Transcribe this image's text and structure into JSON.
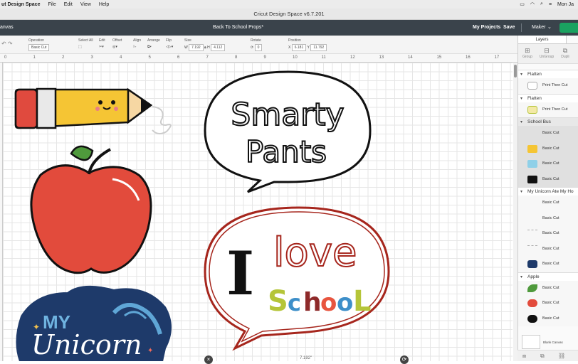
{
  "menubar": {
    "app_name": "ut Design Space",
    "items": [
      "File",
      "Edit",
      "View",
      "Help"
    ],
    "clock": "Mon Ja"
  },
  "window": {
    "title": "Cricut Design Space  v6.7.201"
  },
  "header": {
    "canvas_label": "anvas",
    "project_name": "Back To School Props*",
    "my_projects": "My Projects",
    "save": "Save",
    "machine": "Maker",
    "brand_color": "#1aa260"
  },
  "toolbar": {
    "operation_label": "Operation",
    "operation_value": "Basic Cut",
    "select_all": "Select All",
    "edit": "Edit",
    "offset": "Offset",
    "align": "Align",
    "arrange": "Arrange",
    "flip": "Flip",
    "size_label": "Size",
    "w_label": "W",
    "w_value": "7.192",
    "h_label": "H",
    "h_value": "4.112",
    "rotate_label": "Rotate",
    "rotate_value": "0",
    "position_label": "Position",
    "x_label": "X",
    "x_value": "6.181",
    "y_label": "Y",
    "y_value": "11.792"
  },
  "ruler": {
    "ticks": [
      "0",
      "1",
      "2",
      "3",
      "4",
      "5",
      "6",
      "7",
      "8",
      "9",
      "10",
      "11",
      "12",
      "13",
      "14",
      "15",
      "16",
      "17",
      "18"
    ]
  },
  "canvas": {
    "bubble1_line1": "Smarty",
    "bubble1_line2": "Pants",
    "bubble2_big": "I",
    "bubble2_love": "love",
    "bubble2_school": [
      "S",
      "c",
      "h",
      "o",
      "o",
      "L"
    ],
    "unicorn_my": "MY",
    "unicorn_word": "Unicorn",
    "dimension_label": "7.192\""
  },
  "layers_panel": {
    "tab": "Layers",
    "tools": [
      "Group",
      "UnGroup",
      "Dupli"
    ],
    "groups": [
      {
        "name": "Flatten",
        "items": [
          {
            "label": "Print Then Cut"
          }
        ]
      },
      {
        "name": "Flatten",
        "items": [
          {
            "label": "Print Then Cut"
          }
        ]
      },
      {
        "name": "School Bus",
        "items": [
          {
            "label": "Basic Cut"
          },
          {
            "label": "Basic Cut"
          },
          {
            "label": "Basic Cut"
          },
          {
            "label": "Basic Cut"
          }
        ]
      },
      {
        "name": "My Unicorn Ate My Ho",
        "items": [
          {
            "label": "Basic Cut"
          },
          {
            "label": "Basic Cut"
          },
          {
            "label": "Basic Cut"
          },
          {
            "label": "Basic Cut"
          },
          {
            "label": "Basic Cut"
          }
        ]
      },
      {
        "name": "Apple",
        "items": [
          {
            "label": "Basic Cut"
          },
          {
            "label": "Basic Cut"
          },
          {
            "label": "Basic Cut"
          }
        ]
      }
    ],
    "blank_canvas": "Blank Canvas"
  }
}
